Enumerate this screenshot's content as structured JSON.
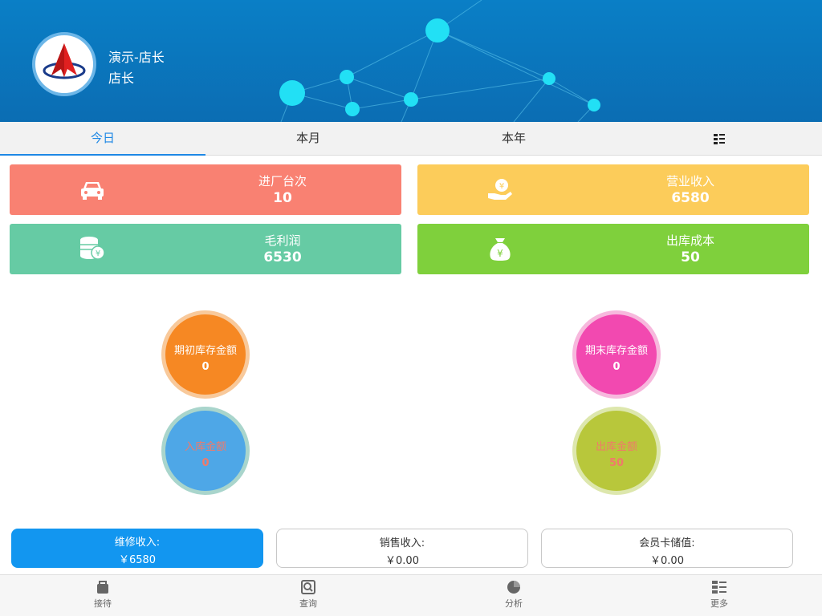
{
  "user": {
    "name": "演示-店长",
    "role": "店长"
  },
  "tabs": [
    {
      "label": "今日"
    },
    {
      "label": "本月"
    },
    {
      "label": "本年"
    }
  ],
  "tab_more_icon": "list-grid-icon",
  "stats": [
    {
      "title": "进厂台次",
      "value": "10",
      "color": "#f98172",
      "icon": "car-icon"
    },
    {
      "title": "营业收入",
      "value": "6580",
      "color": "#fccc5a",
      "icon": "money-hand-icon"
    },
    {
      "title": "毛利润",
      "value": "6530",
      "color": "#66cba4",
      "icon": "coin-stack-icon"
    },
    {
      "title": "出库成本",
      "value": "50",
      "color": "#7fd03c",
      "icon": "money-bag-icon"
    }
  ],
  "circles": [
    {
      "title": "期初库存金额",
      "value": "0",
      "color": "#f68823",
      "ring": "#f8c99b",
      "text_color": "#ffffff"
    },
    {
      "title": "期末库存金额",
      "value": "0",
      "color": "#f249b0",
      "ring": "#f7b8dd",
      "text_color": "#ffffff"
    },
    {
      "title": "入库金额",
      "value": "0",
      "color": "#4ea7e7",
      "ring": "#a9d5cc",
      "text_color": "#f07a6a"
    },
    {
      "title": "出库金额",
      "value": "50",
      "color": "#b8c73b",
      "ring": "#dde7ad",
      "text_color": "#f07a6a"
    }
  ],
  "income": [
    {
      "label": "维修收入:",
      "value": "￥6580"
    },
    {
      "label": "销售收入:",
      "value": "￥0.00"
    },
    {
      "label": "会员卡储值:",
      "value": "￥0.00"
    }
  ],
  "nav": [
    {
      "label": "接待",
      "icon": "reception-icon"
    },
    {
      "label": "查询",
      "icon": "search-icon"
    },
    {
      "label": "分析",
      "icon": "pie-chart-icon"
    },
    {
      "label": "更多",
      "icon": "more-list-icon"
    }
  ]
}
